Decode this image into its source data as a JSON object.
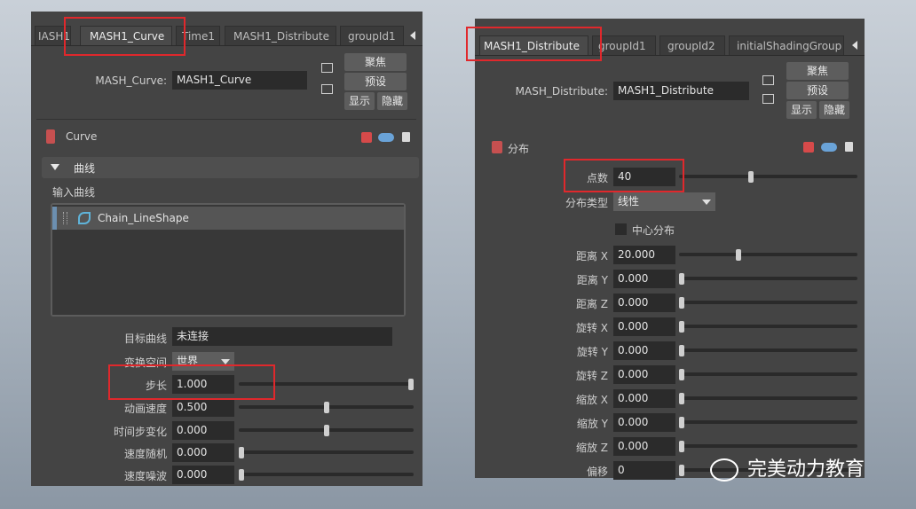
{
  "left_panel": {
    "tabs": [
      "IASH1",
      "MASH1_Curve",
      "Time1",
      "MASH1_Distribute",
      "groupId1"
    ],
    "node_label": "MASH_Curve:",
    "node_value": "MASH1_Curve",
    "buttons": {
      "focus": "聚焦",
      "preset": "预设",
      "show": "显示",
      "hide": "隐藏"
    },
    "module_title": "Curve",
    "section_title": "曲线",
    "input_curves_label": "输入曲线",
    "input_curves": [
      "Chain_LineShape"
    ],
    "target_curve_label": "目标曲线",
    "target_curve_value": "未连接",
    "transform_space_label": "变换空间",
    "transform_space_value": "世界",
    "rows": [
      {
        "label": "步长",
        "value": "1.000",
        "level": 1.0
      },
      {
        "label": "动画速度",
        "value": "0.500",
        "level": 0.5
      },
      {
        "label": "时间步变化",
        "value": "0.000",
        "level": 0.5
      },
      {
        "label": "速度随机",
        "value": "0.000",
        "level": 0.0
      },
      {
        "label": "速度噪波",
        "value": "0.000",
        "level": 0.0
      }
    ]
  },
  "right_panel": {
    "tabs": [
      "MASH1_Distribute",
      "groupId1",
      "groupId2",
      "initialShadingGroup"
    ],
    "node_label": "MASH_Distribute:",
    "node_value": "MASH1_Distribute",
    "buttons": {
      "focus": "聚焦",
      "preset": "预设",
      "show": "显示",
      "hide": "隐藏"
    },
    "module_title": "分布",
    "points_label": "点数",
    "points_value": "40",
    "points_level": 0.4,
    "dist_type_label": "分布类型",
    "dist_type_value": "线性",
    "center_dist_label": "中心分布",
    "rows": [
      {
        "label": "距离 X",
        "value": "20.000",
        "level": 0.33
      },
      {
        "label": "距离 Y",
        "value": "0.000",
        "level": 0.0
      },
      {
        "label": "距离 Z",
        "value": "0.000",
        "level": 0.0
      },
      {
        "label": "旋转 X",
        "value": "0.000",
        "level": 0.0
      },
      {
        "label": "旋转 Y",
        "value": "0.000",
        "level": 0.0
      },
      {
        "label": "旋转 Z",
        "value": "0.000",
        "level": 0.0
      },
      {
        "label": "缩放 X",
        "value": "0.000",
        "level": 0.0
      },
      {
        "label": "缩放 Y",
        "value": "0.000",
        "level": 0.0
      },
      {
        "label": "缩放 Z",
        "value": "0.000",
        "level": 0.0
      },
      {
        "label": "偏移",
        "value": "0",
        "level": 0.0
      }
    ]
  },
  "watermark": "完美动力教育",
  "colors": {
    "highlight": "#e0282c",
    "panel": "#444444",
    "field": "#2b2b2b"
  }
}
